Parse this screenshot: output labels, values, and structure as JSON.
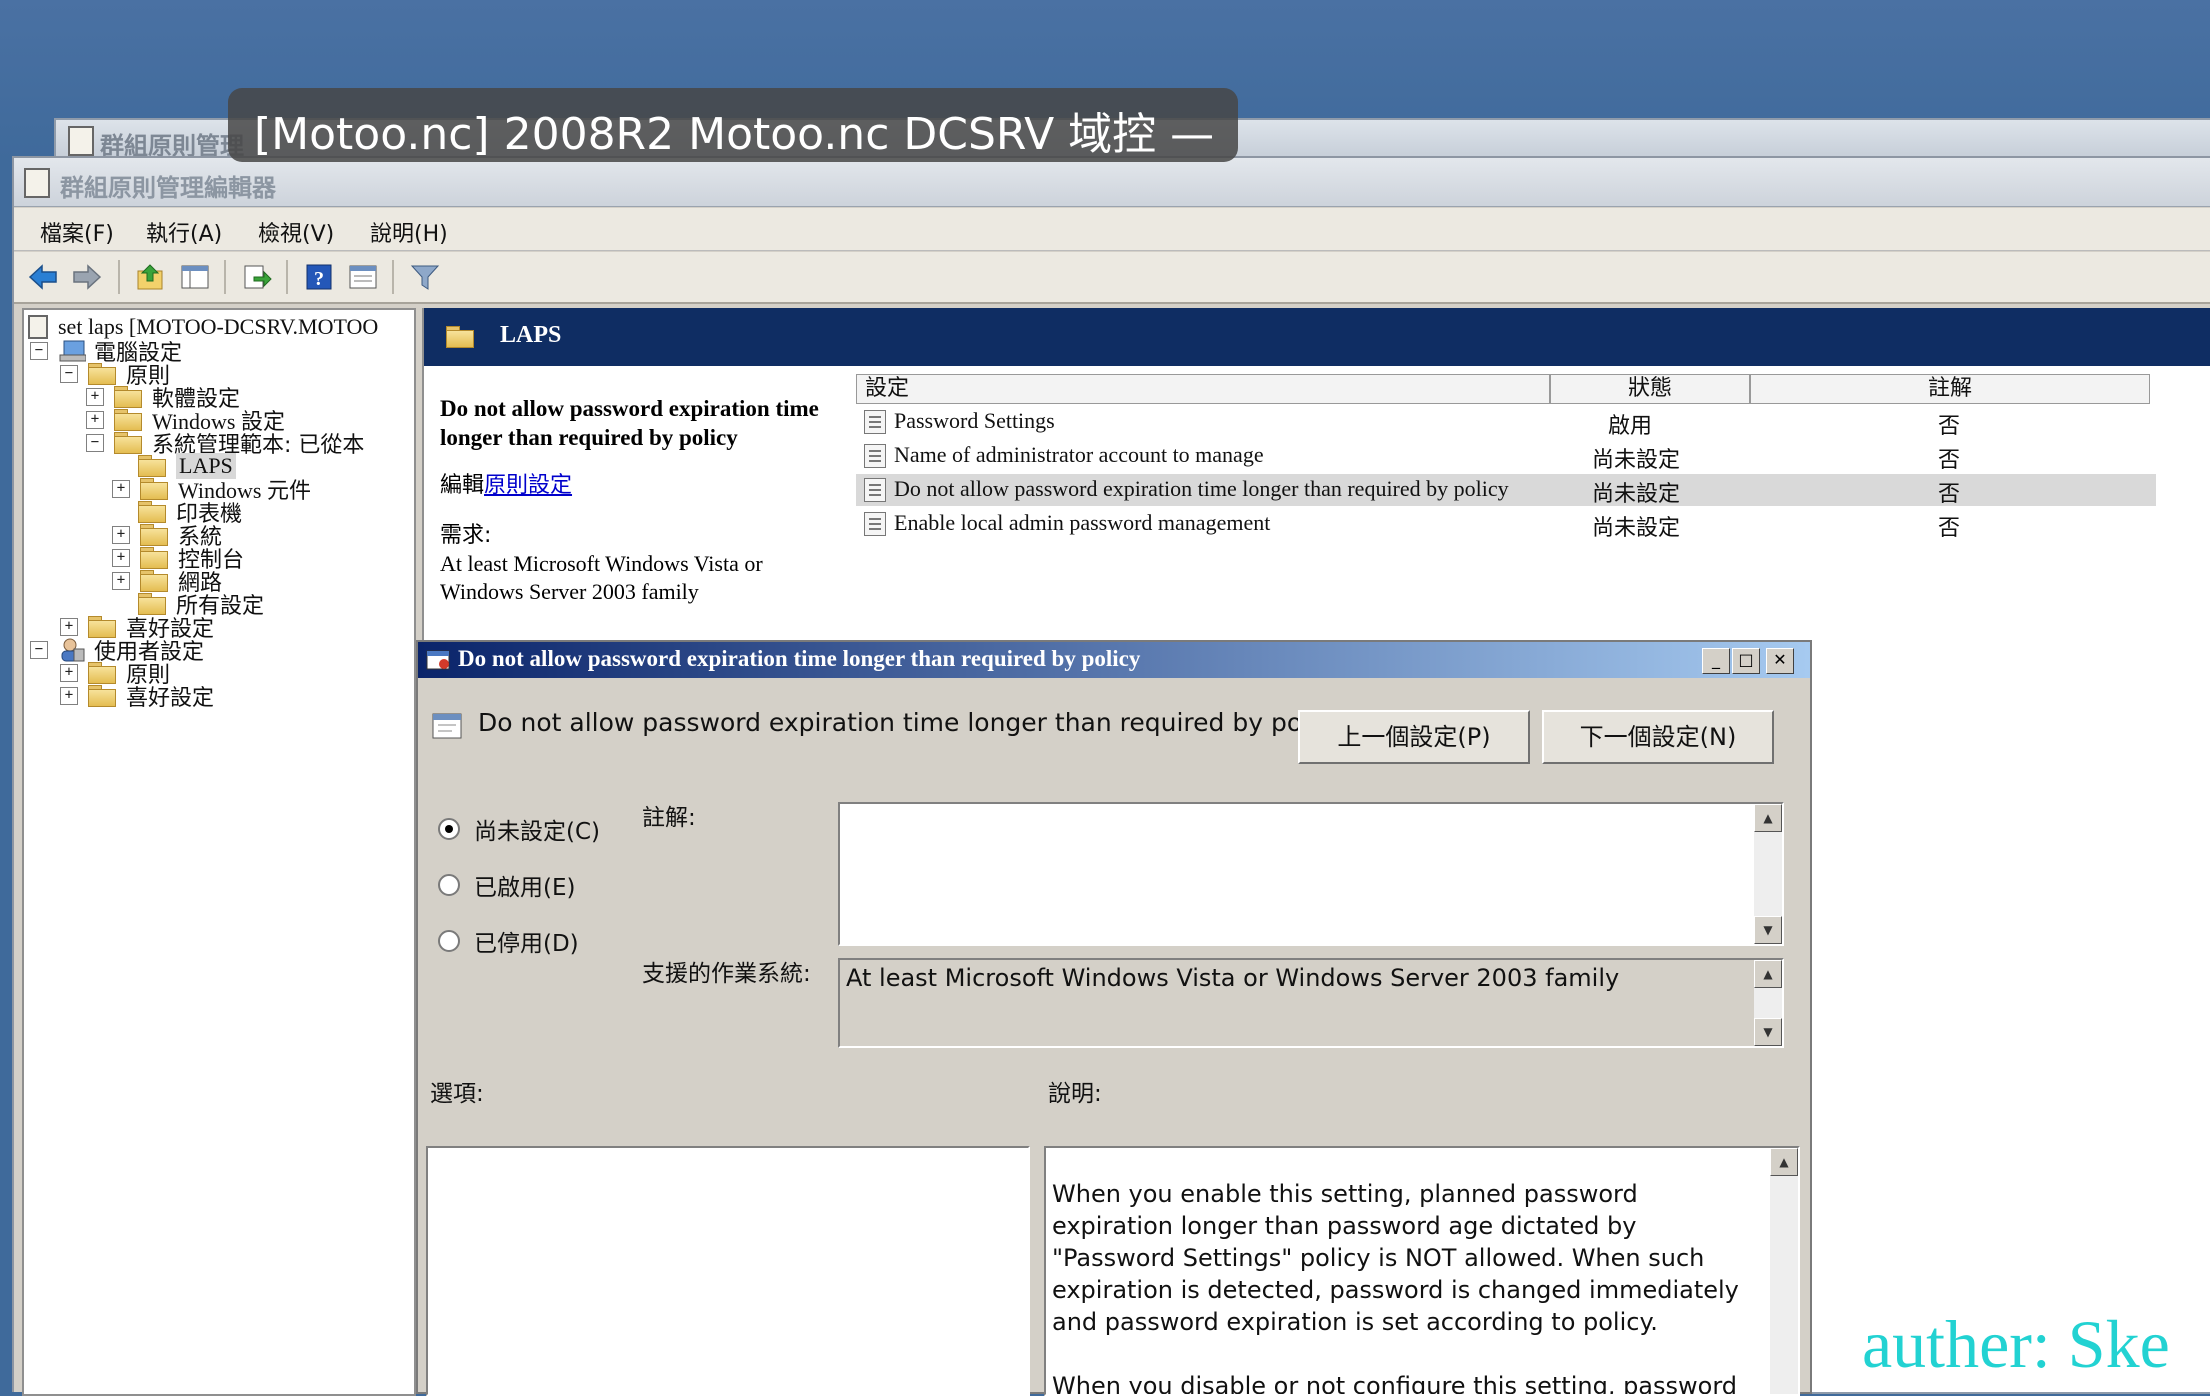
{
  "overlay": {
    "title": "[Motoo.nc] 2008R2 Motoo.nc DCSRV 域控 —"
  },
  "back_window": {
    "title": "群組原則管理"
  },
  "window": {
    "title": "群組原則管理編輯器",
    "menu": [
      "檔案(F)",
      "執行(A)",
      "檢視(V)",
      "說明(H)"
    ]
  },
  "toolbar": {
    "icons": [
      "back-icon",
      "forward-icon",
      "up-icon",
      "show-hide-tree-icon",
      "export-icon",
      "help-icon",
      "properties-icon",
      "filter-icon"
    ]
  },
  "tree": {
    "root": "set laps [MOTOO-DCSRV.MOTOO",
    "computer_config": "電腦設定",
    "policies": "原則",
    "software": "軟體設定",
    "windows_settings": "Windows 設定",
    "admin_templates": "系統管理範本: 已從本",
    "laps": "LAPS",
    "windows_components": "Windows 元件",
    "printers": "印表機",
    "system": "系統",
    "control_panel": "控制台",
    "network": "網路",
    "all_settings": "所有設定",
    "preferences": "喜好設定",
    "user_config": "使用者設定",
    "user_policies": "原則",
    "user_preferences": "喜好設定"
  },
  "right_pane": {
    "header": "LAPS",
    "detail": {
      "heading": "Do not allow password expiration time longer than required by policy",
      "edit_prefix": "編輯",
      "edit_link": "原則設定",
      "req_label": "需求:",
      "req_text": "At least Microsoft Windows Vista or Windows Server 2003 family"
    },
    "columns": [
      "設定",
      "狀態",
      "註解"
    ],
    "rows": [
      {
        "name": "Password Settings",
        "state": "啟用",
        "comment": "否"
      },
      {
        "name": "Name of administrator account to manage",
        "state": "尚未設定",
        "comment": "否"
      },
      {
        "name": "Do not allow password expiration time longer than required by policy",
        "state": "尚未設定",
        "comment": "否"
      },
      {
        "name": "Enable local admin password management",
        "state": "尚未設定",
        "comment": "否"
      }
    ]
  },
  "dialog": {
    "title": "Do not allow password expiration time longer than required by policy",
    "setting_name": "Do not allow password expiration time longer than required by policy",
    "prev_button": "上一個設定(P)",
    "next_button": "下一個設定(N)",
    "radio_not_configured": "尚未設定(C)",
    "radio_enabled": "已啟用(E)",
    "radio_disabled": "已停用(D)",
    "selected_radio": "not_configured",
    "comment_label": "註解:",
    "comment_value": "",
    "supported_label": "支援的作業系統:",
    "supported_value": "At least Microsoft Windows Vista or Windows Server 2003 family",
    "options_label": "選項:",
    "help_label": "說明:",
    "help_p1": "When you enable this setting, planned password expiration longer than password age dictated by \"Password Settings\" policy is NOT allowed. When such expiration is detected, password is changed immediately and password expiration is set according to policy.",
    "help_p2": "When you disable or not configure this setting, password"
  },
  "watermark": "auther: Ske",
  "colors": {
    "desktop": "#3f6a9b",
    "laps_header": "#0f2d63",
    "dialog_title_start": "#0a246a",
    "dialog_title_end": "#a6caf0",
    "watermark": "#22d2d2",
    "link": "#0000cc"
  }
}
